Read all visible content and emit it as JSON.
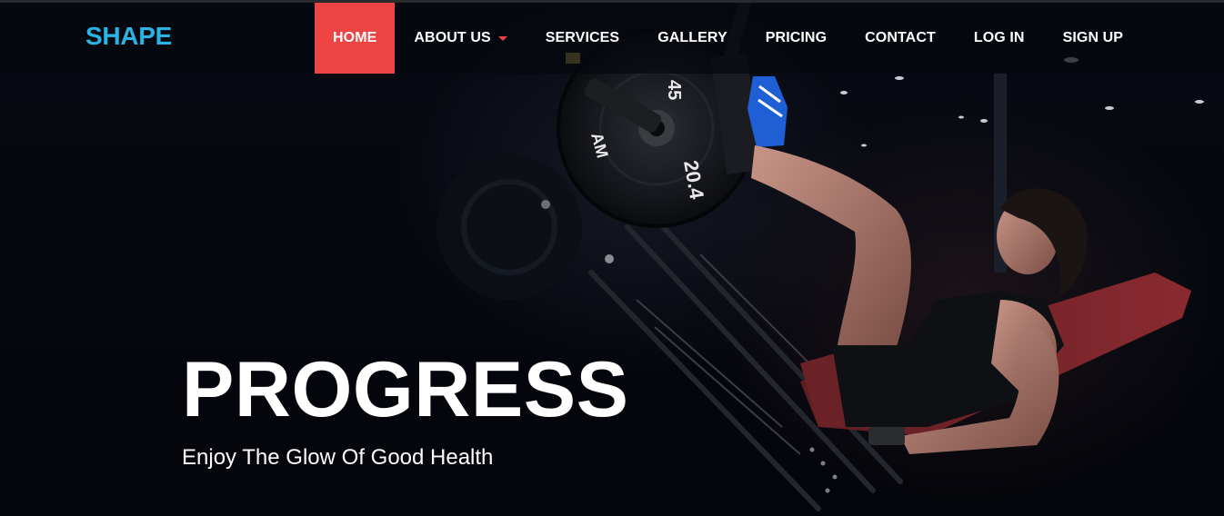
{
  "brand": {
    "name": "SHAPE"
  },
  "nav": {
    "items": [
      {
        "label": "HOME",
        "active": true
      },
      {
        "label": "ABOUT US",
        "has_dropdown": true
      },
      {
        "label": "SERVICES"
      },
      {
        "label": "GALLERY"
      },
      {
        "label": "PRICING"
      },
      {
        "label": "CONTACT"
      },
      {
        "label": "LOG IN"
      },
      {
        "label": "SIGN UP"
      }
    ]
  },
  "hero": {
    "title": "PROGRESS",
    "subtitle": "Enjoy The Glow Of Good Health",
    "plate_text_top": "45",
    "plate_text_right": "20.4",
    "plate_text_left": "AM"
  },
  "colors": {
    "brand": "#2bb4e3",
    "accent": "#ef4444",
    "background": "#05070d",
    "text": "#ffffff"
  }
}
